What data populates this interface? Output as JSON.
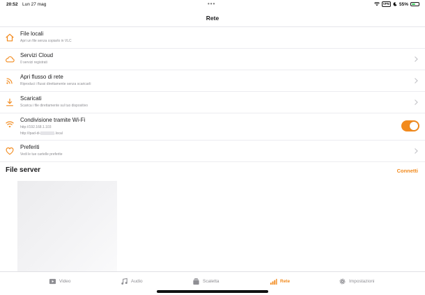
{
  "status_bar": {
    "time": "20:52",
    "date": "Lun 27 mag",
    "vpn": "VPN",
    "battery": "55%",
    "battery_level": 0.55
  },
  "nav": {
    "title": "Rete"
  },
  "colors": {
    "accent": "#f28a1d",
    "subtitle": "#8e8e93",
    "battery": "#34c759"
  },
  "rows": [
    {
      "title": "File locali",
      "subtitle": "Apri un file senza copiarlo in VLC",
      "icon": "house-icon"
    },
    {
      "title": "Servizi Cloud",
      "subtitle": "0 servizi registrati",
      "icon": "cloud-icon"
    },
    {
      "title": "Apri flusso di rete",
      "subtitle": "Riproduci i flussi direttamente senza scaricarli",
      "icon": "rss-icon"
    },
    {
      "title": "Scaricati",
      "subtitle": "Scarica i file direttamente sul tuo dispositivo",
      "icon": "download-icon"
    },
    {
      "title": "Condivisione tramite Wi-Fi",
      "subtitle": "http://192.168.1.103",
      "subtitle2_prefix": "http://ipad-di-",
      "subtitle2_suffix": ".local",
      "icon": "wifi-icon",
      "toggle_on": true
    },
    {
      "title": "Preferiti",
      "subtitle": "Vedi le tue cartelle preferite",
      "icon": "heart-icon"
    }
  ],
  "file_server": {
    "title": "File server",
    "action": "Connetti"
  },
  "tabs": [
    {
      "label": "Video",
      "icon": "video-icon"
    },
    {
      "label": "Audio",
      "icon": "music-note-icon"
    },
    {
      "label": "Scaletta",
      "icon": "playlist-icon"
    },
    {
      "label": "Rete",
      "icon": "network-bars-icon",
      "active": true
    },
    {
      "label": "Impostazioni",
      "icon": "gear-icon"
    }
  ]
}
